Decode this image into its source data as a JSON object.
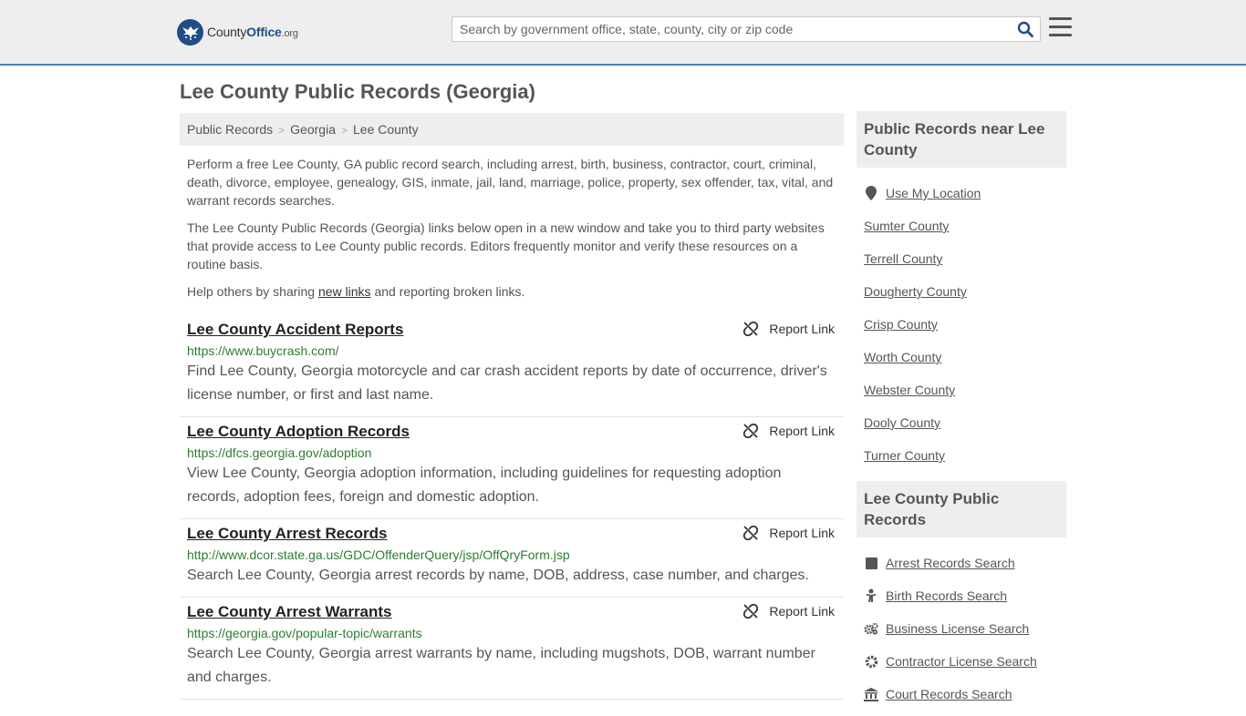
{
  "header": {
    "logo": {
      "brand_a": "County",
      "brand_b": "Office",
      "brand_c": ".org"
    },
    "search_placeholder": "Search by government office, state, county, city or zip code"
  },
  "page_title": "Lee County Public Records (Georgia)",
  "breadcrumb": [
    "Public Records",
    "Georgia",
    "Lee County"
  ],
  "intro": {
    "p1": "Perform a free Lee County, GA public record search, including arrest, birth, business, contractor, court, criminal, death, divorce, employee, genealogy, GIS, inmate, jail, land, marriage, police, property, sex offender, tax, vital, and warrant records searches.",
    "p2": "The Lee County Public Records (Georgia) links below open in a new window and take you to third party websites that provide access to Lee County public records. Editors frequently monitor and verify these resources on a routine basis.",
    "p3_before": "Help others by sharing ",
    "p3_link": "new links",
    "p3_after": " and reporting broken links."
  },
  "report_label": "Report Link",
  "records": [
    {
      "title": "Lee County Accident Reports",
      "url": "https://www.buycrash.com/",
      "desc": "Find Lee County, Georgia motorcycle and car crash accident reports by date of occurrence, driver's license number, or first and last name."
    },
    {
      "title": "Lee County Adoption Records",
      "url": "https://dfcs.georgia.gov/adoption",
      "desc": "View Lee County, Georgia adoption information, including guidelines for requesting adoption records, adoption fees, foreign and domestic adoption."
    },
    {
      "title": "Lee County Arrest Records",
      "url": "http://www.dcor.state.ga.us/GDC/OffenderQuery/jsp/OffQryForm.jsp",
      "desc": "Search Lee County, Georgia arrest records by name, DOB, address, case number, and charges."
    },
    {
      "title": "Lee County Arrest Warrants",
      "url": "https://georgia.gov/popular-topic/warrants",
      "desc": "Search Lee County, Georgia arrest warrants by name, including mugshots, DOB, warrant number and charges."
    }
  ],
  "sidebar": {
    "near_title": "Public Records near Lee County",
    "near_items": [
      "Use My Location",
      "Sumter County",
      "Terrell County",
      "Dougherty County",
      "Crisp County",
      "Worth County",
      "Webster County",
      "Dooly County",
      "Turner County"
    ],
    "records_title": "Lee County Public Records",
    "records_items": [
      {
        "label": "Arrest Records Search",
        "icon": "square-icon"
      },
      {
        "label": "Birth Records Search",
        "icon": "baby-icon"
      },
      {
        "label": "Business License Search",
        "icon": "gears-icon"
      },
      {
        "label": "Contractor License Search",
        "icon": "gear-icon"
      },
      {
        "label": "Court Records Search",
        "icon": "courthouse-icon"
      }
    ]
  }
}
